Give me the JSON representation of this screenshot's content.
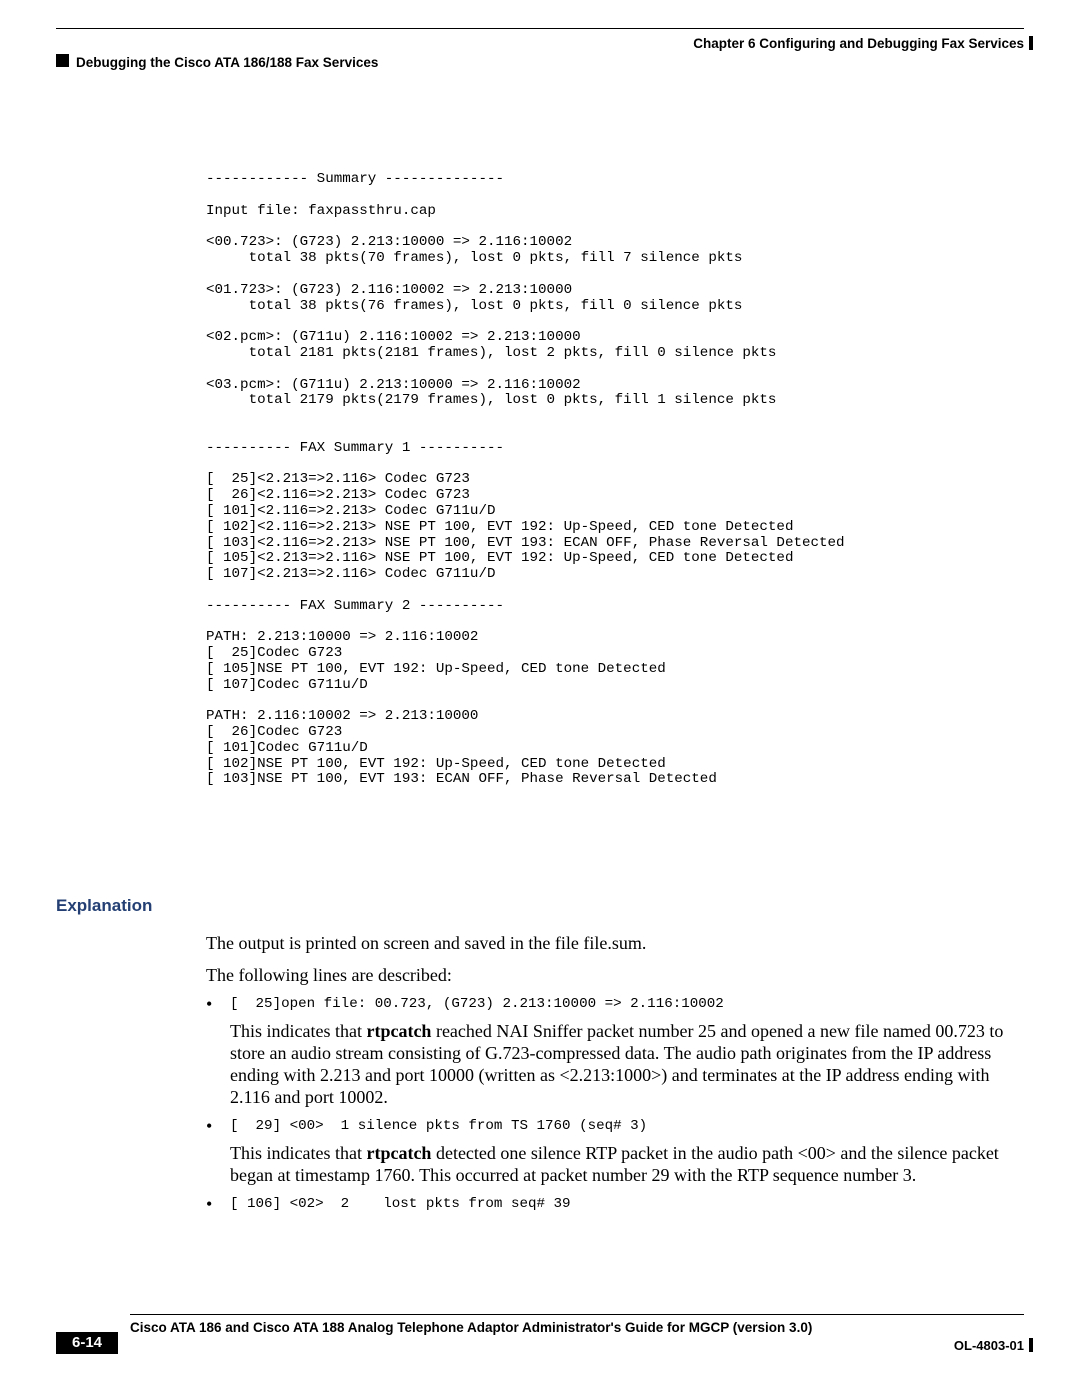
{
  "header": {
    "chapter": "Chapter 6    Configuring and Debugging Fax Services",
    "section": "Debugging the Cisco ATA 186/188 Fax Services"
  },
  "code": "------------ Summary --------------\n\nInput file: faxpassthru.cap\n\n<00.723>: (G723) 2.213:10000 => 2.116:10002\n     total 38 pkts(70 frames), lost 0 pkts, fill 7 silence pkts\n\n<01.723>: (G723) 2.116:10002 => 2.213:10000\n     total 38 pkts(76 frames), lost 0 pkts, fill 0 silence pkts\n\n<02.pcm>: (G711u) 2.116:10002 => 2.213:10000\n     total 2181 pkts(2181 frames), lost 2 pkts, fill 0 silence pkts\n\n<03.pcm>: (G711u) 2.213:10000 => 2.116:10002\n     total 2179 pkts(2179 frames), lost 0 pkts, fill 1 silence pkts\n\n\n---------- FAX Summary 1 ----------\n\n[  25]<2.213=>2.116> Codec G723\n[  26]<2.116=>2.213> Codec G723\n[ 101]<2.116=>2.213> Codec G711u/D\n[ 102]<2.116=>2.213> NSE PT 100, EVT 192: Up-Speed, CED tone Detected\n[ 103]<2.116=>2.213> NSE PT 100, EVT 193: ECAN OFF, Phase Reversal Detected\n[ 105]<2.213=>2.116> NSE PT 100, EVT 192: Up-Speed, CED tone Detected\n[ 107]<2.213=>2.116> Codec G711u/D\n\n---------- FAX Summary 2 ----------\n\nPATH: 2.213:10000 => 2.116:10002\n[  25]Codec G723\n[ 105]NSE PT 100, EVT 192: Up-Speed, CED tone Detected\n[ 107]Codec G711u/D\n\nPATH: 2.116:10002 => 2.213:10000\n[  26]Codec G723\n[ 101]Codec G711u/D\n[ 102]NSE PT 100, EVT 192: Up-Speed, CED tone Detected\n[ 103]NSE PT 100, EVT 193: ECAN OFF, Phase Reversal Detected",
  "explanation": {
    "heading": "Explanation",
    "line1": "The output is printed on screen and saved in the file file.sum.",
    "line2": "The following lines are described:",
    "bullets": [
      {
        "mono": "[  25]open file: 00.723, (G723) 2.213:10000 => 2.116:10002",
        "desc_pre": "This indicates that ",
        "desc_bold": "rtpcatch",
        "desc_post": " reached NAI Sniffer packet number 25 and opened a new file named 00.723 to store an audio stream consisting of G.723-compressed data. The audio path originates from the IP address ending with 2.213 and port 10000 (written as <2.213:1000>) and terminates at the IP address ending with 2.116 and port 10002."
      },
      {
        "mono": "[  29] <00>  1 silence pkts from TS 1760 (seq# 3)",
        "desc_pre": "This indicates that ",
        "desc_bold": "rtpcatch",
        "desc_post": " detected one silence RTP packet in the audio path <00> and the silence packet began at timestamp 1760. This occurred at packet number 29 with the RTP sequence number 3."
      },
      {
        "mono": "[ 106] <02>  2    lost pkts from seq# 39",
        "desc_pre": "",
        "desc_bold": "",
        "desc_post": ""
      }
    ]
  },
  "footer": {
    "title": "Cisco ATA 186 and Cisco ATA 188 Analog Telephone Adaptor Administrator's Guide for MGCP (version 3.0)",
    "page": "6-14",
    "docid": "OL-4803-01"
  }
}
